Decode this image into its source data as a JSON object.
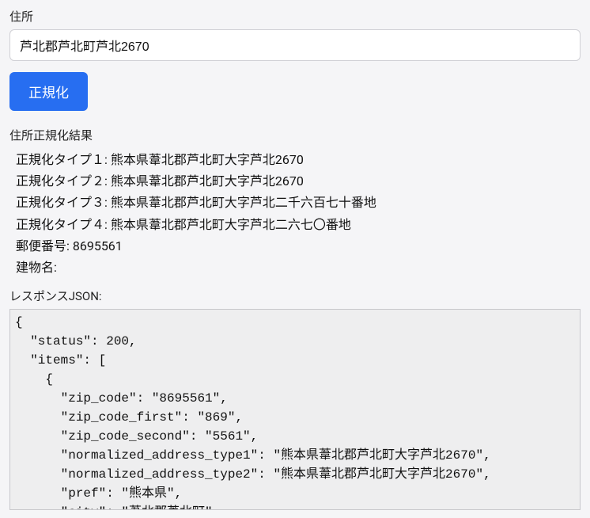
{
  "form": {
    "address_label": "住所",
    "address_value": "芦北郡芦北町芦北2670",
    "normalize_button_label": "正規化"
  },
  "result": {
    "heading": "住所正規化結果",
    "lines": [
      "正規化タイプ１: 熊本県葦北郡芦北町大字芦北2670",
      "正規化タイプ２: 熊本県葦北郡芦北町大字芦北2670",
      "正規化タイプ３: 熊本県葦北郡芦北町大字芦北二千六百七十番地",
      "正規化タイプ４: 熊本県葦北郡芦北町大字芦北二六七〇番地",
      "郵便番号: 8695561",
      "建物名:"
    ]
  },
  "response": {
    "heading": "レスポンスJSON:",
    "body": "{\n  \"status\": 200,\n  \"items\": [\n    {\n      \"zip_code\": \"8695561\",\n      \"zip_code_first\": \"869\",\n      \"zip_code_second\": \"5561\",\n      \"normalized_address_type1\": \"熊本県葦北郡芦北町大字芦北2670\",\n      \"normalized_address_type2\": \"熊本県葦北郡芦北町大字芦北2670\",\n      \"pref\": \"熊本県\",\n      \"city\": \"葦北郡芦北町\","
  }
}
